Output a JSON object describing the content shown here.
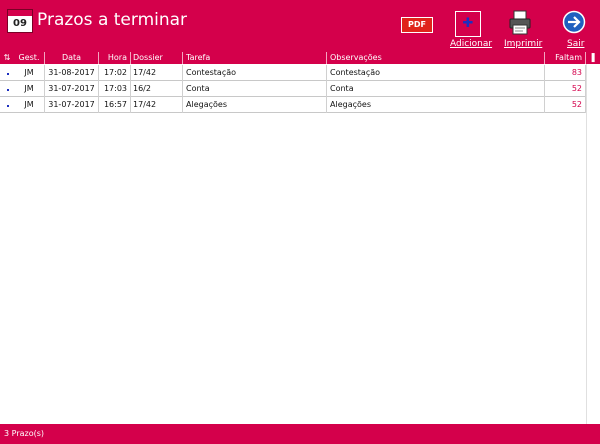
{
  "header": {
    "title": "Prazos a terminar",
    "calendar_day": "09",
    "pdf_label": "PDF",
    "add_label": "Adicionar",
    "print_label": "Imprimir",
    "exit_label": "Sair"
  },
  "table": {
    "columns": [
      "Gest.",
      "Data",
      "Hora",
      "Dossier",
      "Tarefa",
      "Observações",
      "Faltam"
    ],
    "rows": [
      {
        "gest": "JM",
        "data": "31-08-2017",
        "hora": "17:02",
        "dossier": "17/42",
        "tarefa": "Contestação",
        "obs": "Contestação",
        "faltam": "83"
      },
      {
        "gest": "JM",
        "data": "31-07-2017",
        "hora": "17:03",
        "dossier": "16/2",
        "tarefa": "Conta",
        "obs": "Conta",
        "faltam": "52"
      },
      {
        "gest": "JM",
        "data": "31-07-2017",
        "hora": "16:57",
        "dossier": "17/42",
        "tarefa": "Alegações",
        "obs": "Alegações",
        "faltam": "52"
      }
    ]
  },
  "footer": {
    "count_text": "3  Prazo(s)"
  },
  "colors": {
    "accent": "#d4004b",
    "marker": "#1c2fbf"
  },
  "icons": [
    "calendar-icon",
    "pdf-icon",
    "add-icon",
    "printer-icon",
    "exit-arrow-icon",
    "sort-icon"
  ]
}
